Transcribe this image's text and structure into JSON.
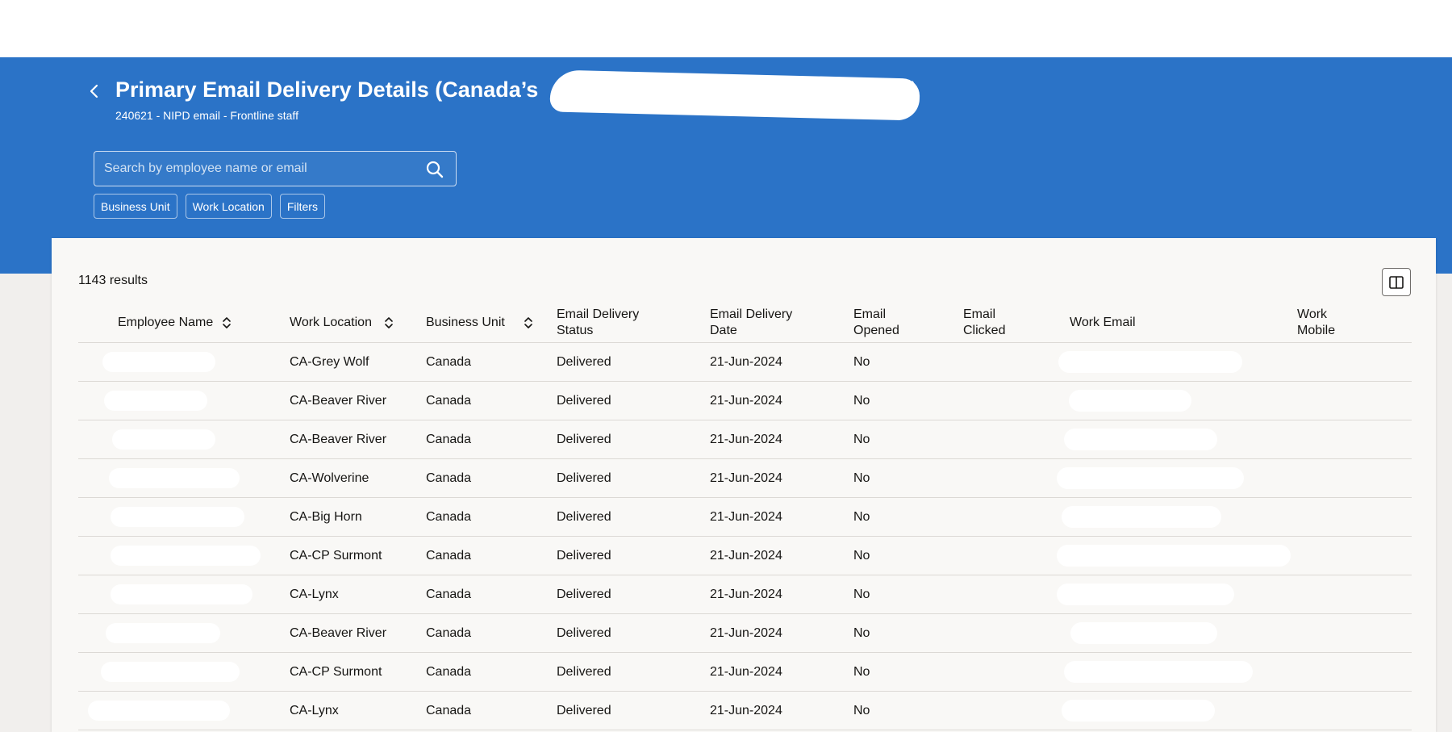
{
  "header": {
    "title": "Primary Email Delivery Details (Canada’s",
    "title_suffix": ")",
    "subtitle": "240621 - NIPD email - Frontline staff"
  },
  "search": {
    "placeholder": "Search by employee name or email",
    "value": ""
  },
  "filters": [
    "Business Unit",
    "Work Location",
    "Filters"
  ],
  "results_count": "1143 results",
  "table": {
    "columns": [
      {
        "label": "Employee Name",
        "sortable": true
      },
      {
        "label": "Work Location",
        "sortable": true
      },
      {
        "label": "Business Unit",
        "sortable": true
      },
      {
        "label": "Email Delivery Status",
        "sortable": false
      },
      {
        "label": "Email Delivery Date",
        "sortable": false
      },
      {
        "label": "Email Opened",
        "sortable": false
      },
      {
        "label": "Email Clicked",
        "sortable": false
      },
      {
        "label": "Work Email",
        "sortable": false
      },
      {
        "label": "Work Mobile",
        "sortable": false
      }
    ],
    "rows": [
      {
        "employee_name": "",
        "work_location": "CA-Grey Wolf",
        "business_unit": "Canada",
        "delivery_status": "Delivered",
        "delivery_date": "21-Jun-2024",
        "opened": "No",
        "clicked": "",
        "work_email": "",
        "work_mobile": ""
      },
      {
        "employee_name": "",
        "work_location": "CA-Beaver River",
        "business_unit": "Canada",
        "delivery_status": "Delivered",
        "delivery_date": "21-Jun-2024",
        "opened": "No",
        "clicked": "",
        "work_email": "",
        "work_mobile": ""
      },
      {
        "employee_name": "",
        "work_location": "CA-Beaver River",
        "business_unit": "Canada",
        "delivery_status": "Delivered",
        "delivery_date": "21-Jun-2024",
        "opened": "No",
        "clicked": "",
        "work_email": "",
        "work_mobile": ""
      },
      {
        "employee_name": "",
        "work_location": "CA-Wolverine",
        "business_unit": "Canada",
        "delivery_status": "Delivered",
        "delivery_date": "21-Jun-2024",
        "opened": "No",
        "clicked": "",
        "work_email": "",
        "work_mobile": ""
      },
      {
        "employee_name": "",
        "work_location": "CA-Big Horn",
        "business_unit": "Canada",
        "delivery_status": "Delivered",
        "delivery_date": "21-Jun-2024",
        "opened": "No",
        "clicked": "",
        "work_email": "",
        "work_mobile": ""
      },
      {
        "employee_name": "",
        "work_location": "CA-CP Surmont",
        "business_unit": "Canada",
        "delivery_status": "Delivered",
        "delivery_date": "21-Jun-2024",
        "opened": "No",
        "clicked": "",
        "work_email": "",
        "work_mobile": ""
      },
      {
        "employee_name": "",
        "work_location": "CA-Lynx",
        "business_unit": "Canada",
        "delivery_status": "Delivered",
        "delivery_date": "21-Jun-2024",
        "opened": "No",
        "clicked": "",
        "work_email": "",
        "work_mobile": ""
      },
      {
        "employee_name": "",
        "work_location": "CA-Beaver River",
        "business_unit": "Canada",
        "delivery_status": "Delivered",
        "delivery_date": "21-Jun-2024",
        "opened": "No",
        "clicked": "",
        "work_email": "",
        "work_mobile": ""
      },
      {
        "employee_name": "",
        "work_location": "CA-CP Surmont",
        "business_unit": "Canada",
        "delivery_status": "Delivered",
        "delivery_date": "21-Jun-2024",
        "opened": "No",
        "clicked": "",
        "work_email": "",
        "work_mobile": ""
      },
      {
        "employee_name": "",
        "work_location": "CA-Lynx",
        "business_unit": "Canada",
        "delivery_status": "Delivered",
        "delivery_date": "21-Jun-2024",
        "opened": "No",
        "clicked": "",
        "work_email": "",
        "work_mobile": ""
      }
    ]
  },
  "colors": {
    "hero_blue": "#2b73c7",
    "card_bg": "#f9f8f6",
    "page_bg": "#f1efed"
  },
  "icons": {
    "back": "chevron-left-icon",
    "search": "search-icon",
    "sort": "sort-icon",
    "columns": "column-layout-icon"
  }
}
